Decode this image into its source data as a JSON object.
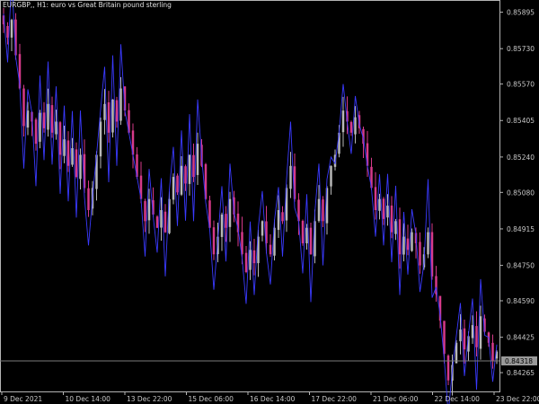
{
  "chart_title": "EURGBP,, H1:  euro vs Great Britain pound sterling",
  "current_price": "0.84318",
  "colors": {
    "background": "#000000",
    "frame": "#b4b4b4",
    "bar_up": "#b8b8b8",
    "bar_down": "#d63a8a",
    "overlay_line": "#3a3aff",
    "price_line": "#7a7a7a",
    "price_label_bg": "#9a9a9a",
    "axis_text": "#c8c8c8"
  },
  "chart_data": {
    "type": "line",
    "title": "EURGBP,, H1:  euro vs Great Britain pound sterling",
    "xlabel": "",
    "ylabel": "",
    "ylim": [
      0.8418,
      0.8595
    ],
    "grid": false,
    "x_tick_labels": [
      "9 Dec 2021",
      "10 Dec 14:00",
      "13 Dec 22:00",
      "15 Dec 06:00",
      "16 Dec 14:00",
      "17 Dec 22:00",
      "21 Dec 06:00",
      "22 Dec 14:00",
      "23 Dec 22:00"
    ],
    "y_ticks": [
      0.85895,
      0.8573,
      0.8557,
      0.85405,
      0.8524,
      0.8508,
      0.84915,
      0.8475,
      0.8459,
      0.84425,
      0.84265
    ],
    "y_tick_labels": [
      "0.85895",
      "0.85730",
      "0.85570",
      "0.85405",
      "0.85240",
      "0.85080",
      "0.84915",
      "0.84750",
      "0.84590",
      "0.84425",
      "0.84265"
    ],
    "hidden_tick_labels": [
      "0.85565"
    ],
    "series": [
      {
        "values": [
          0.8584,
          0.8578,
          0.8586,
          0.857,
          0.8555,
          0.8538,
          0.8545,
          0.854,
          0.853,
          0.8544,
          0.8537,
          0.8548,
          0.8535,
          0.854,
          0.8525,
          0.8532,
          0.852,
          0.8528,
          0.8515,
          0.8525,
          0.851,
          0.85,
          0.851,
          0.8525,
          0.854,
          0.8548,
          0.8535,
          0.855,
          0.854,
          0.8555,
          0.8545,
          0.8535,
          0.8525,
          0.8515,
          0.8505,
          0.8495,
          0.8505,
          0.8498,
          0.8492,
          0.85,
          0.849,
          0.8505,
          0.8515,
          0.8508,
          0.852,
          0.8512,
          0.8525,
          0.8515,
          0.853,
          0.852,
          0.8505,
          0.8492,
          0.848,
          0.8488,
          0.8498,
          0.8492,
          0.8505,
          0.8498,
          0.849,
          0.848,
          0.8472,
          0.8482,
          0.8476,
          0.8488,
          0.8495,
          0.8485,
          0.848,
          0.8492,
          0.85,
          0.8495,
          0.851,
          0.852,
          0.8505,
          0.8495,
          0.8485,
          0.8492,
          0.848,
          0.8495,
          0.8505,
          0.8495,
          0.851,
          0.852,
          0.8525,
          0.8535,
          0.8545,
          0.854,
          0.8535,
          0.8542,
          0.8537,
          0.853,
          0.852,
          0.851,
          0.85,
          0.8505,
          0.8496,
          0.8502,
          0.849,
          0.8495,
          0.848,
          0.8488,
          0.8482,
          0.849,
          0.8485,
          0.8475,
          0.848,
          0.849,
          0.847,
          0.8462,
          0.845,
          0.8435,
          0.8423,
          0.843,
          0.844,
          0.8446,
          0.8437,
          0.8443,
          0.8448,
          0.8438,
          0.8452,
          0.8445,
          0.844,
          0.8432,
          0.8436
        ]
      }
    ]
  }
}
